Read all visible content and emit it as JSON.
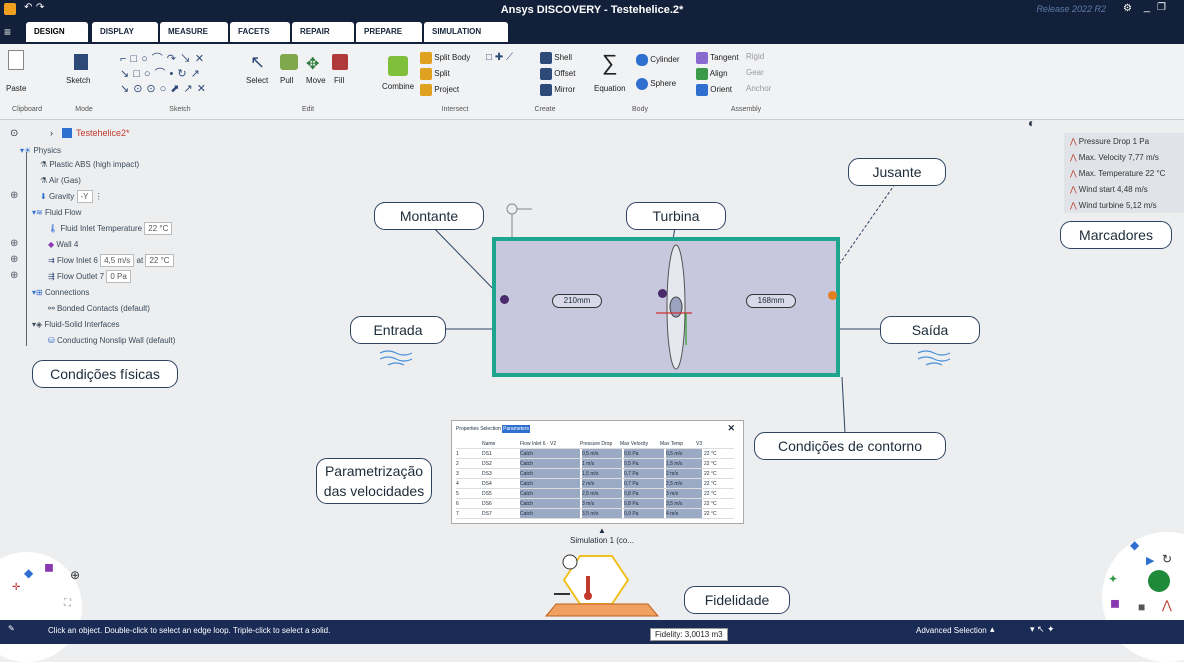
{
  "window": {
    "title": "Ansys DISCOVERY - Testehelice.2*",
    "release": "Release 2022 R2"
  },
  "tabs": [
    {
      "label": "DESIGN"
    },
    {
      "label": "DISPLAY"
    },
    {
      "label": "MEASURE"
    },
    {
      "label": "FACETS"
    },
    {
      "label": "REPAIR"
    },
    {
      "label": "PREPARE"
    },
    {
      "label": "SIMULATION"
    }
  ],
  "ribbon": {
    "groups": [
      "Clipboard",
      "Mode",
      "Sketch",
      "Edit",
      "Intersect",
      "Create",
      "Body",
      "Assembly"
    ],
    "items": {
      "paste": "Paste",
      "sketch": "Sketch",
      "select": "Select",
      "pull": "Pull",
      "move": "Move",
      "fill": "Fill",
      "combine": "Combine",
      "split_body": "Split Body",
      "split": "Split",
      "project": "Project",
      "shell": "Shell",
      "offset": "Offset",
      "mirror": "Mirror",
      "equation": "Equation",
      "cylinder": "Cylinder",
      "sphere": "Sphere",
      "tangent": "Tangent",
      "rigid": "Rigid",
      "align": "Align",
      "gear": "Gear",
      "orient": "Orient",
      "anchor": "Anchor"
    }
  },
  "breadcrumb": {
    "file": "Testehelice2*"
  },
  "tree": {
    "physics": "Physics",
    "plastic": "Plastic ABS (high impact)",
    "air": "Air (Gas)",
    "gravity": "Gravity",
    "gravity_dir": "-Y",
    "fluid_flow": "Fluid Flow",
    "fluid_temp_label": "Fluid Inlet Temperature",
    "fluid_temp_value": "22 °C",
    "wall": "Wall 4",
    "flow_inlet": "Flow Inlet 6",
    "flow_inlet_vel": "4,5 m/s",
    "flow_inlet_at": "at",
    "flow_inlet_temp": "22 °C",
    "flow_outlet": "Flow Outlet 7",
    "flow_outlet_val": "0 Pa",
    "connections": "Connections",
    "bonded": "Bonded Contacts (default)",
    "fluid_solid": "Fluid-Solid Interfaces",
    "conducting": "Conducting Nonslip Wall (default)"
  },
  "callouts": {
    "montante": "Montante",
    "turbina": "Turbina",
    "jusante": "Jusante",
    "marcadores": "Marcadores",
    "entrada": "Entrada",
    "saida": "Saída",
    "condicoes_fisicas": "Condições físicas",
    "condicoes_contorno": "Condições de contorno",
    "parametrizacao": "Parametrização das velocidades",
    "fidelidade": "Fidelidade"
  },
  "domain": {
    "dim_left": "210mm",
    "dim_right": "168mm"
  },
  "markers": [
    {
      "label": "Pressure Drop",
      "value": "1 Pa"
    },
    {
      "label": "Max. Velocity",
      "value": "7,77 m/s"
    },
    {
      "label": "Max. Temperature",
      "value": "22 °C"
    },
    {
      "label": "Wind start",
      "value": "4,48 m/s"
    },
    {
      "label": "Wind turbine",
      "value": "5,12 m/s"
    }
  ],
  "simtable": {
    "tabs": [
      "Properties",
      "Selection",
      "Parameters"
    ],
    "headers": [
      "",
      "Name",
      "Flow Inlet 6 · V2",
      "Pressure Drop",
      "Max Velocity",
      "Max Temp",
      "V3"
    ],
    "rows": [
      {
        "n": "1",
        "name": "DS1",
        "a": "Catch",
        "b": "0,5 m/s",
        "c": "0,5 Pa",
        "d": "0,5 m/s",
        "e": "22 °C",
        "f": "1 m/s"
      },
      {
        "n": "2",
        "name": "DS2",
        "a": "Catch",
        "b": "1 m/s",
        "c": "0,5 Pa",
        "d": "1,5 m/s",
        "e": "22 °C",
        "f": "2 m/s"
      },
      {
        "n": "3",
        "name": "DS3",
        "a": "Catch",
        "b": "1,5 m/s",
        "c": "0,7 Pa",
        "d": "2 m/s",
        "e": "22 °C",
        "f": "3 m/s"
      },
      {
        "n": "4",
        "name": "DS4",
        "a": "Catch",
        "b": "2 m/s",
        "c": "0,7 Pa",
        "d": "2,5 m/s",
        "e": "22 °C",
        "f": "4 m/s"
      },
      {
        "n": "5",
        "name": "DS5",
        "a": "Catch",
        "b": "2,5 m/s",
        "c": "0,8 Pa",
        "d": "3 m/s",
        "e": "22 °C",
        "f": "5 m/s"
      },
      {
        "n": "6",
        "name": "DS6",
        "a": "Catch",
        "b": "3 m/s",
        "c": "0,8 Pa",
        "d": "3,5 m/s",
        "e": "22 °C",
        "f": "6 m/s"
      },
      {
        "n": "7",
        "name": "DS7",
        "a": "Catch",
        "b": "3,5 m/s",
        "c": "0,9 Pa",
        "d": "4 m/s",
        "e": "22 °C",
        "f": "7 m/s"
      }
    ]
  },
  "simulation": {
    "label": "Simulation 1 (co..."
  },
  "status": {
    "hint": "Click an object. Double-click to select an edge loop. Triple-click to select a solid.",
    "selection": "Advanced Selection",
    "fidelity": "Fidelity: 3,0013 m3"
  },
  "colors": {
    "accent": "#1ea58f",
    "titlebar": "#13203a",
    "status": "#1a2c56"
  }
}
